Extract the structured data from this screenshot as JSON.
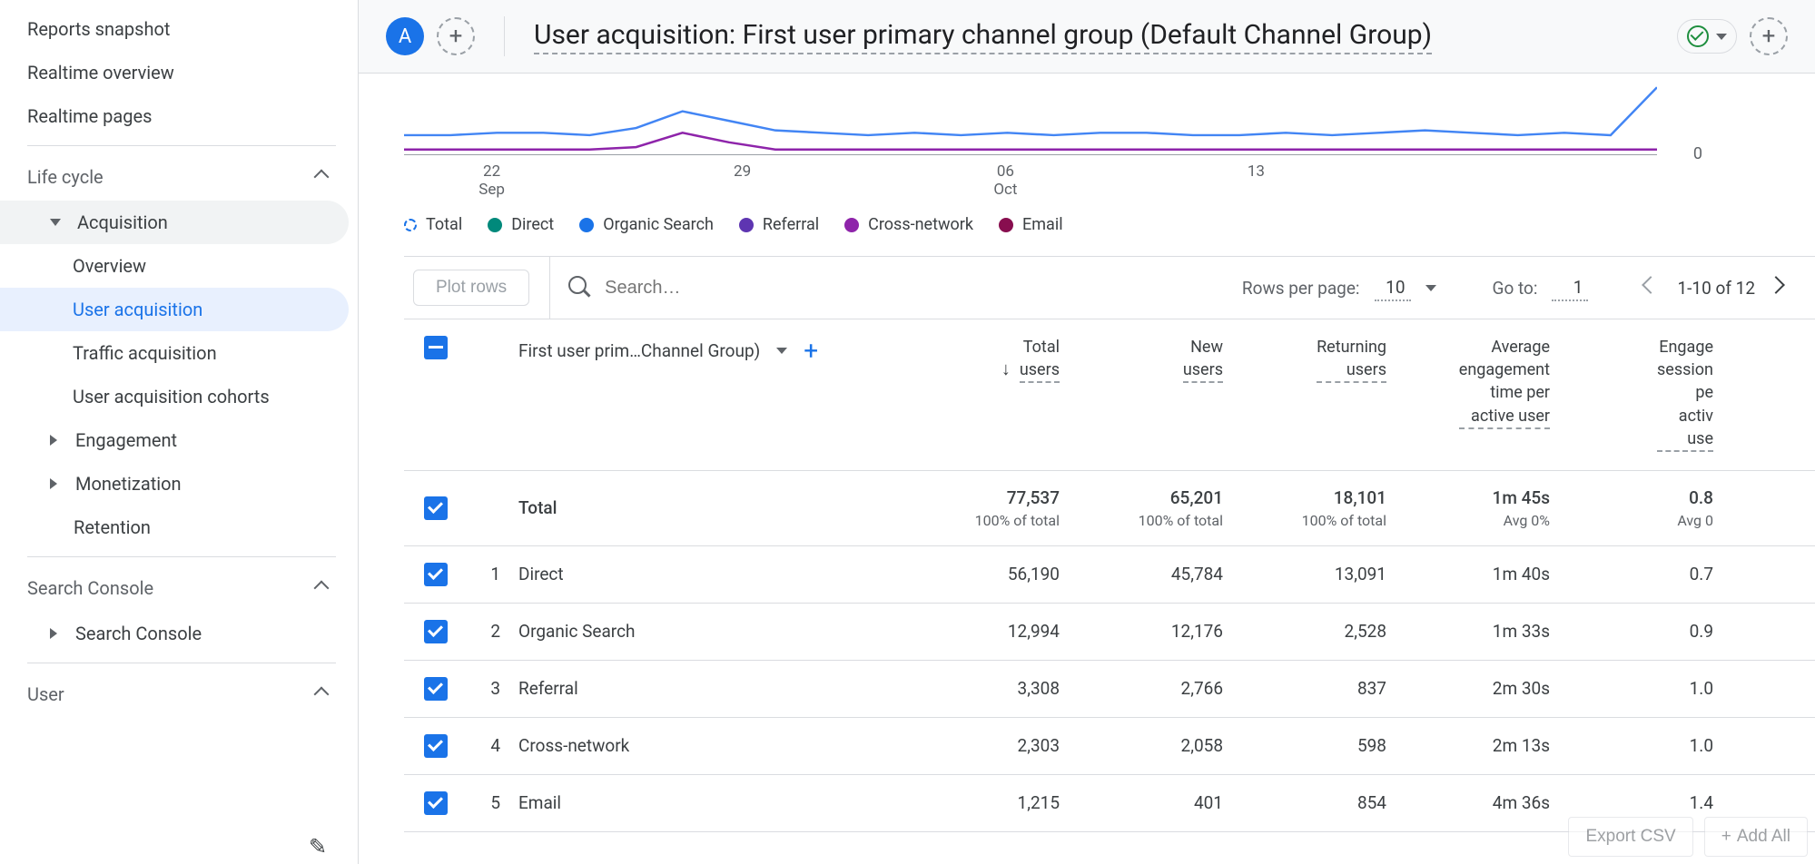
{
  "sidebar": {
    "items_top": [
      "Reports snapshot",
      "Realtime overview",
      "Realtime pages"
    ],
    "life_cycle": {
      "label": "Life cycle",
      "acquisition": {
        "label": "Acquisition",
        "children": [
          "Overview",
          "User acquisition",
          "Traffic acquisition",
          "User acquisition cohorts"
        ]
      },
      "engagement": "Engagement",
      "monetization": "Monetization",
      "retention": "Retention"
    },
    "search_console": {
      "label": "Search Console",
      "child": "Search Console"
    },
    "user": {
      "label": "User"
    }
  },
  "header": {
    "avatar": "A",
    "title": "User acquisition: First user primary channel group (Default Channel Group)"
  },
  "chart_data": {
    "type": "line",
    "x_ticks": [
      "22\nSep",
      "29",
      "06\nOct",
      "13"
    ],
    "ylabel_zero": "0",
    "legend": [
      {
        "name": "Total",
        "color": "#1a73e8",
        "dashed": true
      },
      {
        "name": "Direct",
        "color": "#00897b"
      },
      {
        "name": "Organic Search",
        "color": "#1a73e8"
      },
      {
        "name": "Referral",
        "color": "#5e35b1"
      },
      {
        "name": "Cross-network",
        "color": "#8e24aa"
      },
      {
        "name": "Email",
        "color": "#880e4f"
      }
    ],
    "series": [
      {
        "name": "Total",
        "color": "#4285f4",
        "values": [
          8,
          8,
          9,
          9,
          8,
          11,
          18,
          14,
          10,
          9,
          8,
          9,
          8,
          9,
          8,
          9,
          9,
          8,
          8,
          9,
          8,
          9,
          10,
          9,
          8,
          9,
          8,
          28
        ]
      },
      {
        "name": "Cross-network",
        "color": "#8e24aa",
        "values": [
          2,
          2,
          2,
          2,
          2,
          3,
          9,
          5,
          2,
          2,
          2,
          2,
          2,
          2,
          2,
          2,
          2,
          2,
          2,
          2,
          2,
          2,
          2,
          2,
          2,
          2,
          2,
          2
        ]
      }
    ]
  },
  "toolbar": {
    "plot_rows": "Plot rows",
    "search_placeholder": "Search…",
    "rows_per_page_label": "Rows per page:",
    "rows_per_page_value": "10",
    "go_to_label": "Go to:",
    "go_to_value": "1",
    "range": "1-10 of 12"
  },
  "table": {
    "dimension_label": "First user prim…Channel Group)",
    "columns": [
      "Total users",
      "New users",
      "Returning users",
      "Average engagement time per active user",
      "Engaged sessions per active user"
    ],
    "columns_short": [
      [
        "Total",
        "users"
      ],
      [
        "New",
        "users"
      ],
      [
        "Returning",
        "users"
      ],
      [
        "Average",
        "engagement",
        "time per",
        "active user"
      ],
      [
        "Engage",
        "session",
        "pe",
        "activ",
        "use"
      ]
    ],
    "total": {
      "label": "Total",
      "values": [
        "77,537",
        "65,201",
        "18,101",
        "1m 45s",
        "0.8"
      ],
      "sub": [
        "100% of total",
        "100% of total",
        "100% of total",
        "Avg 0%",
        "Avg 0"
      ]
    },
    "rows": [
      {
        "idx": "1",
        "dim": "Direct",
        "v": [
          "56,190",
          "45,784",
          "13,091",
          "1m 40s",
          "0.7"
        ]
      },
      {
        "idx": "2",
        "dim": "Organic Search",
        "v": [
          "12,994",
          "12,176",
          "2,528",
          "1m 33s",
          "0.9"
        ]
      },
      {
        "idx": "3",
        "dim": "Referral",
        "v": [
          "3,308",
          "2,766",
          "837",
          "2m 30s",
          "1.0"
        ]
      },
      {
        "idx": "4",
        "dim": "Cross-network",
        "v": [
          "2,303",
          "2,058",
          "598",
          "2m 13s",
          "1.0"
        ]
      },
      {
        "idx": "5",
        "dim": "Email",
        "v": [
          "1,215",
          "401",
          "854",
          "4m 36s",
          "1.4"
        ]
      }
    ]
  },
  "bottom": {
    "export": "Export CSV",
    "add_all": "Add All"
  }
}
